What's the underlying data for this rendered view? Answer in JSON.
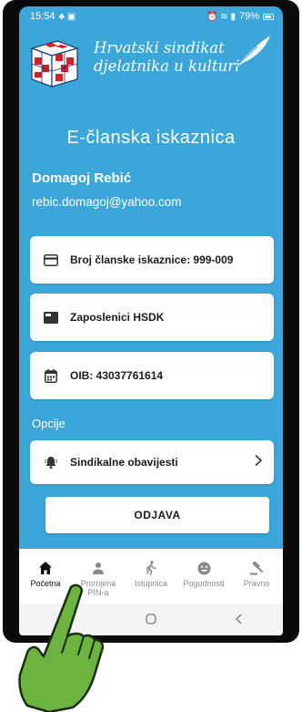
{
  "status_bar": {
    "time": "15:54",
    "battery": "79%"
  },
  "header": {
    "org_line1": "Hrvatski sindikat",
    "org_line2": "djelatnika u kulturi"
  },
  "title": "E-članska iskaznica",
  "user": {
    "name": "Domagoj Rebić",
    "email": "rebic.domagoj@yahoo.com"
  },
  "cards": {
    "membership": "Broj članske iskaznice: 999-009",
    "employer": "Zaposlenici HSDK",
    "oib": "OIB: 43037761614"
  },
  "options": {
    "section_label": "Opcije",
    "notifications": "Sindikalne obavijesti"
  },
  "logout_label": "ODJAVA",
  "bottom_nav": {
    "home": "Početna",
    "pin_line1": "Promjena",
    "pin_line2": "PIN-a",
    "exit": "Istupnica",
    "benefits": "Pogodnosti",
    "legal": "Pravno"
  },
  "colors": {
    "primary_blue": "#3aa6d9",
    "card_bg": "#ffffff",
    "hand_green": "#6cb33f"
  },
  "icons": {
    "membership": "credit-card-icon",
    "employer": "folder-icon",
    "oib": "calendar-icon",
    "notifications": "bell-icon",
    "chevron": "chevron-right-icon",
    "home": "home-icon",
    "pin": "person-icon",
    "exit": "walking-person-icon",
    "benefits": "smiley-icon",
    "legal": "gavel-icon"
  }
}
